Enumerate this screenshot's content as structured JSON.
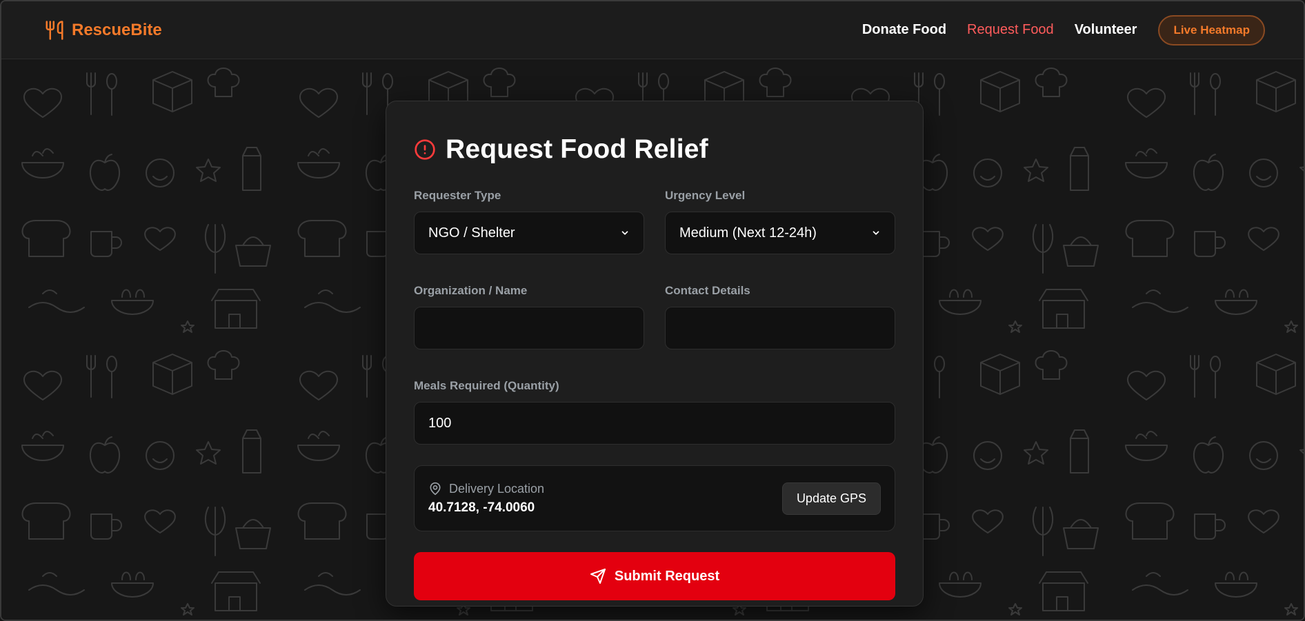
{
  "app": {
    "brand_name": "RescueBite",
    "brand_icon": "utensils-icon",
    "accent_color": "#f47a2a",
    "danger_color": "#e3000f"
  },
  "nav": {
    "links": [
      {
        "label": "Donate Food",
        "active": false
      },
      {
        "label": "Request Food",
        "active": true
      },
      {
        "label": "Volunteer",
        "active": false
      }
    ],
    "heatmap_label": "Live Heatmap"
  },
  "form": {
    "title": "Request Food Relief",
    "title_icon": "alert-circle-icon",
    "requester_type": {
      "label": "Requester Type",
      "value": "NGO / Shelter"
    },
    "urgency": {
      "label": "Urgency Level",
      "value": "Medium (Next 12-24h)"
    },
    "org_name": {
      "label": "Organization / Name",
      "value": ""
    },
    "contact": {
      "label": "Contact Details",
      "value": ""
    },
    "meals": {
      "label": "Meals Required (Quantity)",
      "value": "100"
    },
    "location": {
      "label": "Delivery Location",
      "icon": "map-pin-icon",
      "coords": "40.7128, -74.0060",
      "gps_button": "Update GPS"
    },
    "submit_label": "Submit Request",
    "submit_icon": "send-icon"
  }
}
